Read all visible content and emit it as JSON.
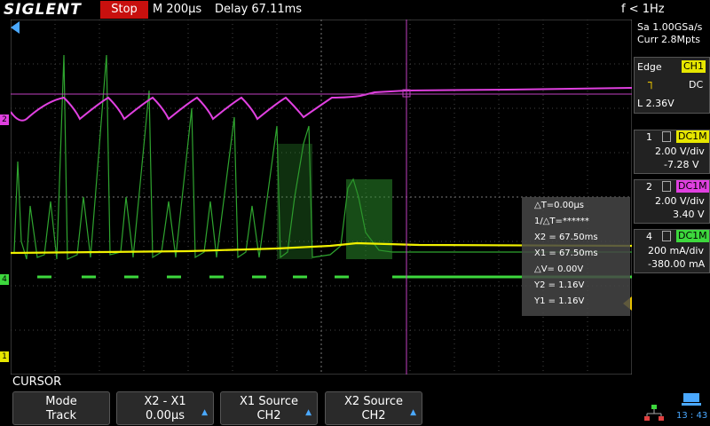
{
  "topbar": {
    "brand": "SIGLENT",
    "run_state": "Stop",
    "timebase": "M 200μs",
    "delay": "Delay 67.11ms",
    "frequency": "f < 1Hz"
  },
  "acquisition": {
    "sample_rate": "Sa 1.00GSa/s",
    "memory": "Curr 2.8Mpts"
  },
  "trigger": {
    "type": "Edge",
    "source": "CH1",
    "coupling": "DC",
    "level": "L  2.36V"
  },
  "channels": [
    {
      "num": "1",
      "coupling": "DC1M",
      "scale": "2.00 V/div",
      "offset": "-7.28 V",
      "color": "#e6e600"
    },
    {
      "num": "2",
      "coupling": "DC1M",
      "scale": "2.00 V/div",
      "offset": "3.40 V",
      "color": "#e040e0"
    },
    {
      "num": "4",
      "coupling": "DC1M",
      "scale": "200 mA/div",
      "offset": "-380.00 mA",
      "color": "#3dd83d"
    }
  ],
  "measure": {
    "dt": "△T=0.00μs",
    "inv_dt": "1/△T=******",
    "x2": "X2 = 67.50ms",
    "x1": "X1 = 67.50ms",
    "dv": "△V= 0.00V",
    "y2": "Y2 = 1.16V",
    "y1": "Y1 = 1.16V"
  },
  "menu": {
    "title": "CURSOR",
    "keys": [
      {
        "line1": "Mode",
        "line2": "Track"
      },
      {
        "line1": "X2 - X1",
        "line2": "0.00μs"
      },
      {
        "line1": "X1 Source",
        "line2": "CH2"
      },
      {
        "line1": "X2 Source",
        "line2": "CH2"
      }
    ]
  },
  "clock": "13 : 43",
  "markers": {
    "ch2": "2",
    "ch4": "4",
    "ch1": "1"
  },
  "colors": {
    "ch1": "#e6e600",
    "ch2": "#e040e0",
    "ch4": "#3dd83d",
    "cursor": "#c040c0",
    "stop": "#c8100e"
  }
}
